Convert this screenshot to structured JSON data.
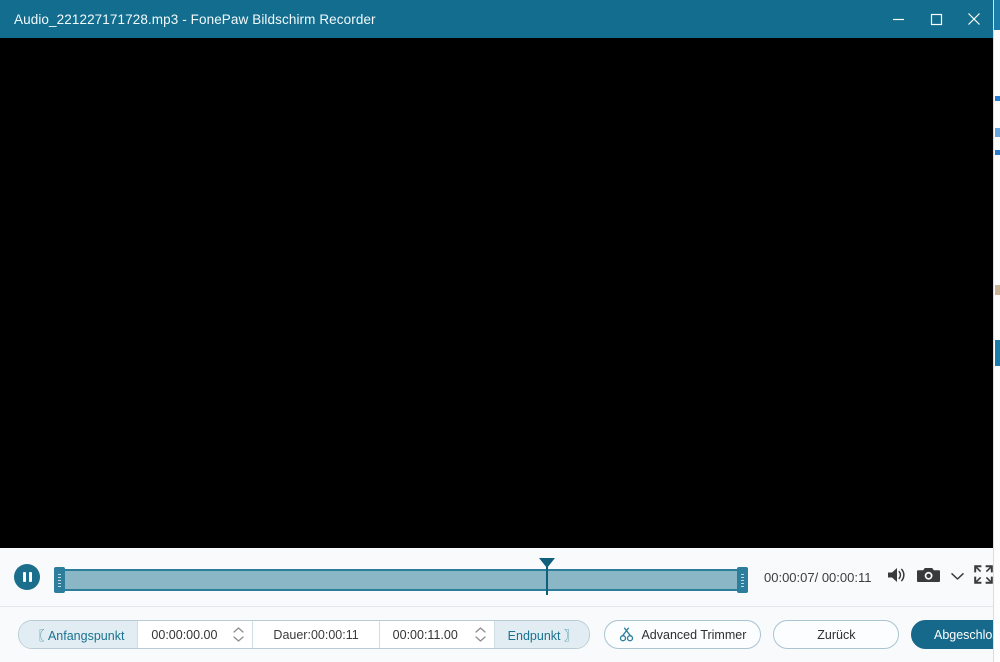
{
  "window": {
    "title_file": "Audio_221227171728.mp3",
    "title_separator": "-",
    "title_app": "FonePaw Bildschirm Recorder",
    "title_full": "Audio_221227171728.mp3  -  FonePaw Bildschirm Recorder",
    "controls": {
      "minimize": "minimize-icon",
      "maximize": "maximize-icon",
      "close": "close-icon"
    },
    "titlebar_color": "#136d8e"
  },
  "video": {
    "background_color": "#000000"
  },
  "playback": {
    "play_state": "pause",
    "play_icon": "pause-icon",
    "current_time": "00:00:07",
    "total_time": "00:00:11",
    "time_readout": "00:00:07/ 00:00:11",
    "playhead_percent": 71,
    "trim_start_percent": 0,
    "trim_end_percent": 100,
    "icons": {
      "volume": "volume-icon",
      "snapshot": "camera-icon",
      "snapshot_menu": "chevron-down-icon",
      "fullscreen": "fullscreen-icon"
    }
  },
  "toolbar": {
    "start_point_label": "〖 Anfangspunkt",
    "start_point_value": "00:00:00.00",
    "duration_label": "Dauer:00:00:11",
    "end_point_value": "00:00:11.00",
    "end_point_label": "Endpunkt 〗",
    "advanced_trimmer_label": "Advanced Trimmer",
    "advanced_trimmer_icon": "scissors-icon",
    "back_label": "Zurück",
    "done_label": "Abgeschlossen",
    "accent_color": "#16698a",
    "link_color": "#19728f"
  }
}
